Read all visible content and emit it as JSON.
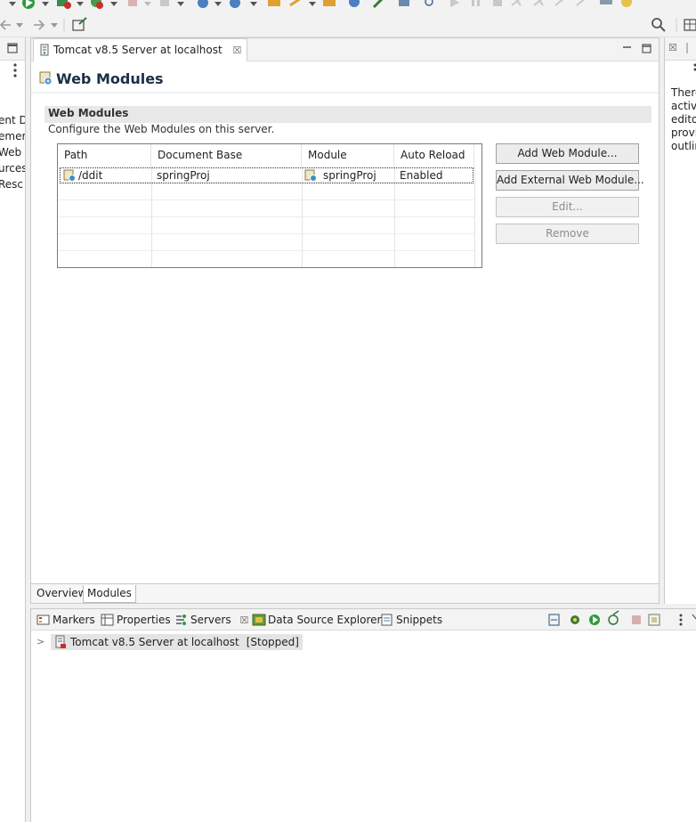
{
  "editor": {
    "tab_title": "Tomcat v8.5 Server at localhost",
    "tab_close": "☒",
    "form_title": "Web Modules",
    "section": {
      "title": "Web Modules",
      "description": "Configure the Web Modules on this server."
    },
    "table": {
      "columns": [
        "Path",
        "Document Base",
        "Module",
        "Auto Reload"
      ],
      "rows": [
        {
          "path": "/ddit",
          "document_base": "springProj",
          "module": "springProj",
          "auto_reload": "Enabled"
        }
      ]
    },
    "buttons": {
      "add": "Add Web Module...",
      "add_external": "Add External Web Module...",
      "edit": "Edit...",
      "remove": "Remove"
    },
    "bottom_tabs": [
      "Overview",
      "Modules"
    ],
    "active_bottom_tab": "Modules"
  },
  "left_view": {
    "fragments": [
      "ent D",
      "emen",
      "Web S",
      "urces",
      " Resc"
    ]
  },
  "right_view": {
    "fragments": [
      "There",
      "active",
      "editor",
      "provi",
      "outlin"
    ]
  },
  "servers_panel": {
    "tabs": [
      "Markers",
      "Properties",
      "Servers",
      "Data Source Explorer",
      "Snippets"
    ],
    "tab_close": "☒",
    "active_tab": "Servers",
    "server": {
      "name": "Tomcat v8.5 Server at localhost",
      "status": "[Stopped]"
    }
  },
  "colors": {
    "title": "#1b2f46",
    "section_bar": "#e8e8e8",
    "selection": "#e4e4e4",
    "run_green": "#2e9a3c"
  },
  "icons": [
    "search-icon",
    "server-icon",
    "module-icon",
    "markers-icon",
    "properties-icon",
    "servers-icon",
    "datasource-icon",
    "snippets-icon",
    "start-icon",
    "debug-icon",
    "stop-icon",
    "publish-icon",
    "minimize-icon",
    "maximize-icon"
  ]
}
